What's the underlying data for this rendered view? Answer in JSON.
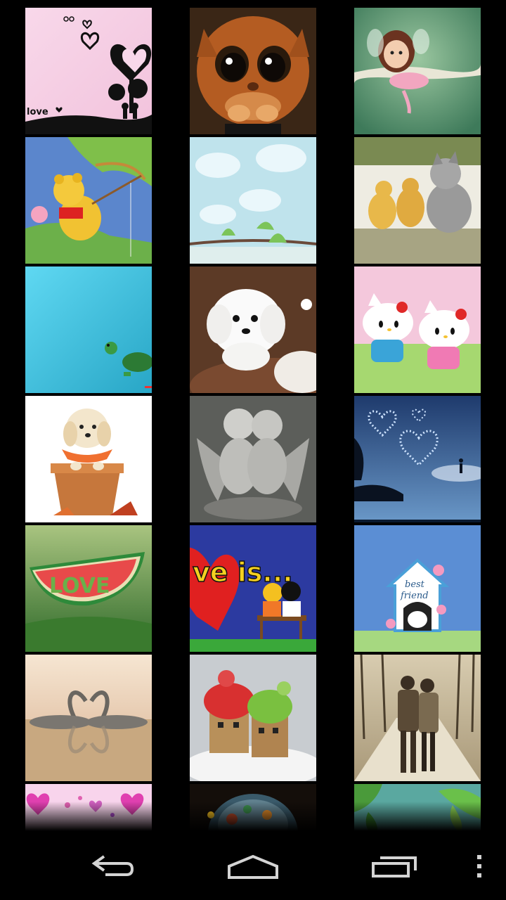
{
  "gallery": {
    "tiles": [
      {
        "name": "hearts-silhouette-thumbnail",
        "scene": "hearts-silhouette",
        "caption": "love"
      },
      {
        "name": "sad-cat-thumbnail",
        "scene": "sad-cat"
      },
      {
        "name": "fairy-girl-thumbnail",
        "scene": "fairy-girl"
      },
      {
        "name": "pooh-fishing-thumbnail",
        "scene": "pooh-fishing"
      },
      {
        "name": "clouds-birds-thumbnail",
        "scene": "clouds-birds"
      },
      {
        "name": "ducklings-kitten-thumbnail",
        "scene": "ducklings-kitten"
      },
      {
        "name": "turtle-cyan-thumbnail",
        "scene": "turtle-cyan"
      },
      {
        "name": "white-puppy-thumbnail",
        "scene": "white-puppy"
      },
      {
        "name": "hello-kitty-thumbnail",
        "scene": "hello-kitty"
      },
      {
        "name": "puppy-flowerpot-thumbnail",
        "scene": "puppy-flowerpot"
      },
      {
        "name": "angel-statues-thumbnail",
        "scene": "angel-statues"
      },
      {
        "name": "night-hearts-thumbnail",
        "scene": "night-hearts"
      },
      {
        "name": "watermelon-love-thumbnail",
        "scene": "watermelon-love",
        "caption": "LOVE"
      },
      {
        "name": "love-is-thumbnail",
        "scene": "love-is",
        "caption": "ve is..."
      },
      {
        "name": "best-friend-thumbnail",
        "scene": "best-friend",
        "caption_line1": "best",
        "caption_line2": "friend"
      },
      {
        "name": "swans-heart-thumbnail",
        "scene": "swans-heart"
      },
      {
        "name": "danbo-hats-thumbnail",
        "scene": "danbo-hats"
      },
      {
        "name": "couple-walking-thumbnail",
        "scene": "couple-walking"
      },
      {
        "name": "pink-hearts-thumbnail",
        "scene": "pink-hearts"
      },
      {
        "name": "glass-bubble-thumbnail",
        "scene": "glass-bubble"
      },
      {
        "name": "green-leaves-thumbnail",
        "scene": "green-leaves"
      }
    ]
  },
  "navbar": {
    "buttons": [
      {
        "name": "back-button",
        "icon": "back-arrow-icon"
      },
      {
        "name": "home-button",
        "icon": "home-icon"
      },
      {
        "name": "recent-apps-button",
        "icon": "recent-apps-icon"
      },
      {
        "name": "menu-button",
        "icon": "overflow-menu-icon"
      }
    ]
  },
  "colors": {
    "background": "#000000",
    "navbar_icon": "#d4d4d4"
  }
}
